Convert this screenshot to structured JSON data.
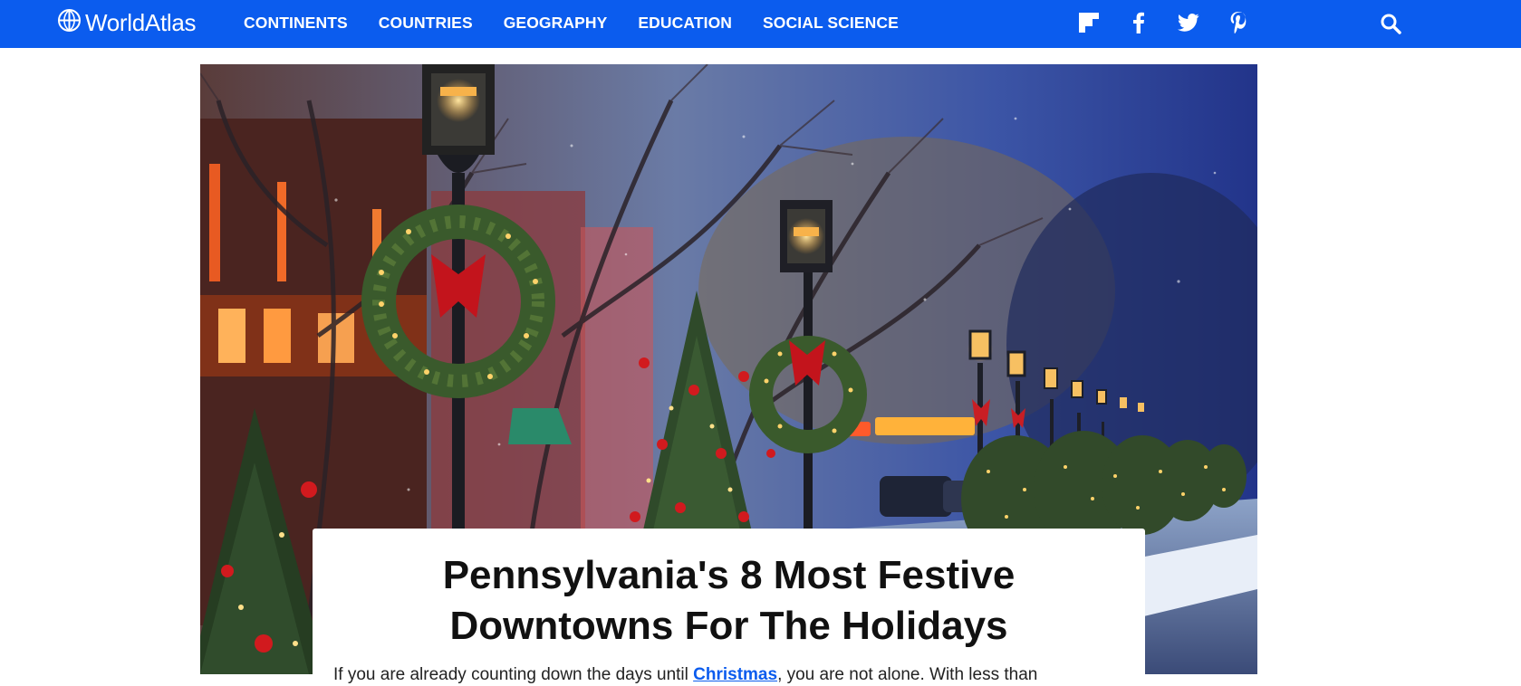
{
  "header": {
    "brand": "WorldAtlas",
    "nav": [
      {
        "label": "CONTINENTS"
      },
      {
        "label": "COUNTRIES"
      },
      {
        "label": "GEOGRAPHY"
      },
      {
        "label": "EDUCATION"
      },
      {
        "label": "SOCIAL SCIENCE"
      }
    ],
    "social_icons": [
      "flipboard-icon",
      "facebook-icon",
      "twitter-icon",
      "pinterest-icon"
    ],
    "search_icon": "search-icon",
    "bar_color": "#0b5cee"
  },
  "article": {
    "hero_alt": "Snowy downtown street with wreaths on lamp posts and decorated Christmas trees",
    "title": "Pennsylvania's 8 Most Festive Downtowns For The Holidays",
    "intro_before": "If you are already counting down the days until ",
    "intro_link": "Christmas",
    "intro_after": ", you are not alone. With less than"
  }
}
